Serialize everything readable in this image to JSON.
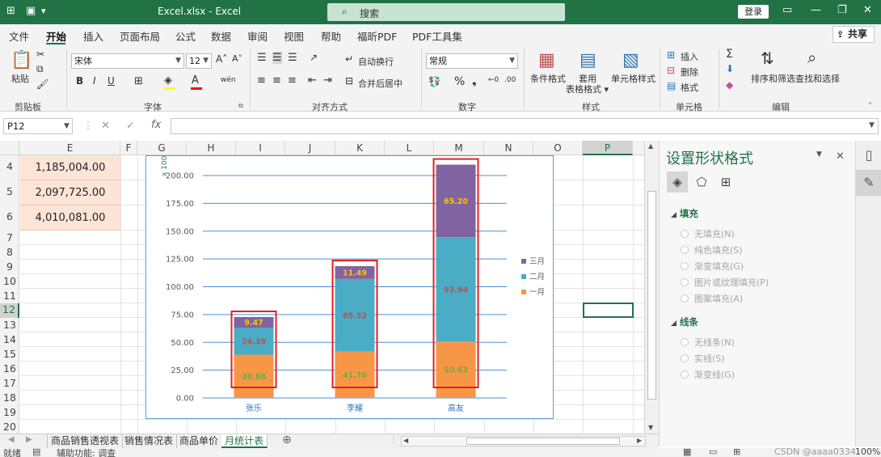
{
  "titlebar": {
    "autosave_icon": "autosave-icon",
    "title": "Excel.xlsx  -  Excel",
    "search_placeholder": "搜索",
    "login": "登录",
    "colors": {
      "brand": "#217346"
    }
  },
  "menu": {
    "tabs": [
      "文件",
      "开始",
      "插入",
      "页面布局",
      "公式",
      "数据",
      "审阅",
      "视图",
      "帮助",
      "福昕PDF",
      "PDF工具集"
    ],
    "share": "共享"
  },
  "ribbon": {
    "clipboard": {
      "paste": "粘贴",
      "label": "剪贴板"
    },
    "font": {
      "name": "宋体",
      "size": "12",
      "bold": "B",
      "italic": "I",
      "underline": "U",
      "label": "字体"
    },
    "alignment": {
      "wrap": "自动换行",
      "merge": "合并后居中",
      "label": "对齐方式"
    },
    "number": {
      "format": "常规",
      "label": "数字"
    },
    "styles": {
      "conditional": "条件格式",
      "table_format": "套用\n表格格式",
      "cell_styles": "单元格样式",
      "label": "样式"
    },
    "cells": {
      "insert": "插入",
      "delete": "删除",
      "format": "格式",
      "label": "单元格"
    },
    "editing": {
      "sort_filter": "排序和筛选",
      "find_select": "查找和选择",
      "label": "编辑"
    }
  },
  "formula_bar": {
    "name_box": "P12",
    "formula": ""
  },
  "sheet": {
    "columns": [
      "E",
      "F",
      "G",
      "H",
      "I",
      "J",
      "K",
      "L",
      "M",
      "N",
      "O",
      "P"
    ],
    "rows": [
      "4",
      "5",
      "6",
      "7",
      "8",
      "9",
      "10",
      "11",
      "12",
      "13",
      "14",
      "15",
      "16",
      "17",
      "18",
      "19",
      "20"
    ],
    "e_values": [
      "1,185,004.00",
      "2,097,725.00",
      "4,010,081.00"
    ]
  },
  "chart_data": {
    "type": "bar",
    "stacked": true,
    "categories": [
      "张乐",
      "李耀",
      "高友"
    ],
    "series": [
      {
        "name": "一月",
        "values": [
          38.88,
          41.7,
          50.63
        ],
        "color": "#f79646"
      },
      {
        "name": "二月",
        "values": [
          24.39,
          65.32,
          93.94
        ],
        "color": "#4bacc6"
      },
      {
        "name": "三月",
        "values": [
          9.47,
          11.49,
          65.2
        ],
        "color": "#8064a2"
      }
    ],
    "data_label_colors": [
      "#70ad47",
      "#c0504d",
      "#ffc000"
    ],
    "yticks": [
      "0.00",
      "25.00",
      "50.00",
      "75.00",
      "100.00",
      "125.00",
      "150.00",
      "175.00",
      "200.00"
    ],
    "ylim": [
      0,
      200
    ],
    "yunit": "x 1000",
    "legend_position": "right",
    "grid": true,
    "highlight_color": "#e02020"
  },
  "pane": {
    "title": "设置形状格式",
    "fill_section": "填充",
    "fill_options": [
      "无填充(N)",
      "纯色填充(S)",
      "渐变填充(G)",
      "图片或纹理填充(P)",
      "图案填充(A)"
    ],
    "line_section": "线条",
    "line_options": [
      "无线条(N)",
      "实线(S)",
      "渐变线(G)"
    ]
  },
  "sheet_tabs": {
    "tabs": [
      "商品销售透视表",
      "销售情况表",
      "商品单价",
      "月统计表"
    ],
    "active": "月统计表"
  },
  "status": {
    "ready": "就绪",
    "accessibility": "辅助功能: 调查",
    "watermark": "CSDN @aaaa0334",
    "zoom": "100%"
  }
}
